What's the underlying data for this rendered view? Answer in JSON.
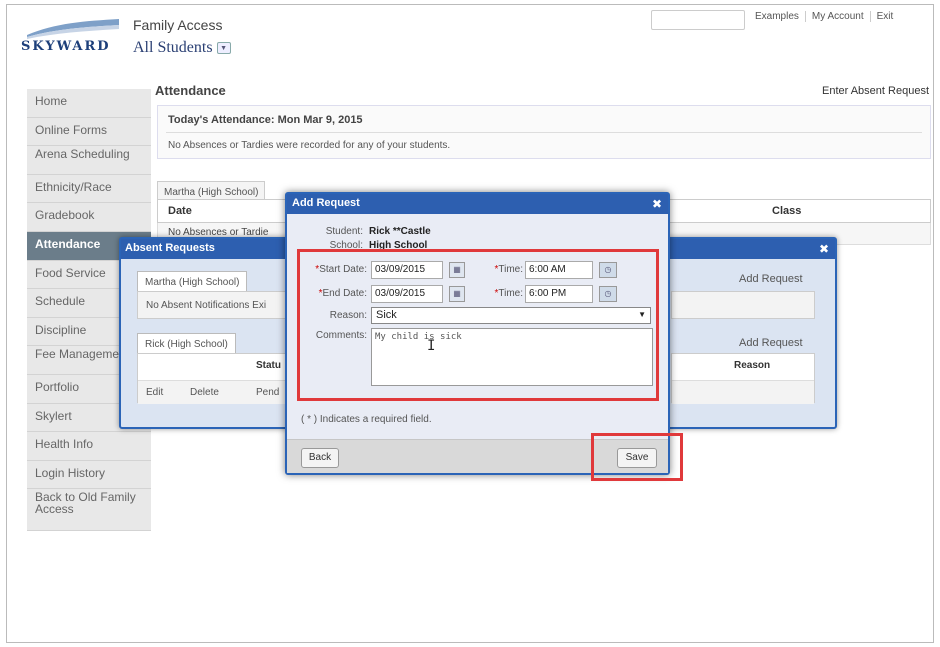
{
  "header": {
    "logo_text": "SKYWARD",
    "app_title": "Family Access",
    "student_select": "All Students",
    "top_links": [
      "Examples",
      "My Account",
      "Exit"
    ]
  },
  "sidebar": {
    "items": [
      {
        "label": "Home"
      },
      {
        "label": "Online Forms"
      },
      {
        "label": "Arena Scheduling"
      },
      {
        "label": "Ethnicity/Race"
      },
      {
        "label": "Gradebook"
      },
      {
        "label": "Attendance"
      },
      {
        "label": "Food Service"
      },
      {
        "label": "Schedule"
      },
      {
        "label": "Discipline"
      },
      {
        "label": "Fee Management"
      },
      {
        "label": "Portfolio"
      },
      {
        "label": "Skylert"
      },
      {
        "label": "Health Info"
      },
      {
        "label": "Login History"
      },
      {
        "label": "Back to Old Family Access"
      }
    ],
    "active_index": 5
  },
  "main": {
    "title": "Attendance",
    "enter_absent_request": "Enter Absent Request",
    "today_title": "Today's Attendance: Mon Mar 9, 2015",
    "today_message": "No Absences or Tardies were recorded for any of your students.",
    "martha_tab": "Martha (High School)",
    "grid_headers": [
      "Date",
      "Class"
    ],
    "grid_row": "No Absences or Tardie"
  },
  "absent_dialog": {
    "title": "Absent Requests",
    "martha_tab": "Martha (High School)",
    "martha_message": "No Absent Notifications Exi",
    "add_request_1": "Add Request",
    "rick_tab": "Rick (High School)",
    "add_request_2": "Add Request",
    "status_header": "Statu",
    "reason_header": "Reason",
    "edit": "Edit",
    "delete": "Delete",
    "status_value": "Pend"
  },
  "add_request": {
    "title": "Add Request",
    "student_label": "Student:",
    "student_value": "Rick **Castle",
    "school_label": "School:",
    "school_value": "High School",
    "start_date_label": "Start Date:",
    "start_date": "03/09/2015",
    "start_time_label": "Time:",
    "start_time": "6:00 AM",
    "end_date_label": "End Date:",
    "end_date": "03/09/2015",
    "end_time_label": "Time:",
    "end_time": "6:00 PM",
    "reason_label": "Reason:",
    "reason": "Sick",
    "comments_label": "Comments:",
    "comments": "My child is sick",
    "required_note": "( * ) Indicates a required field.",
    "back": "Back",
    "save": "Save"
  },
  "colors": {
    "dialog_header": "#2d5fb0",
    "highlight": "#e0393b",
    "sidebar_active": "#6b7d8a"
  }
}
